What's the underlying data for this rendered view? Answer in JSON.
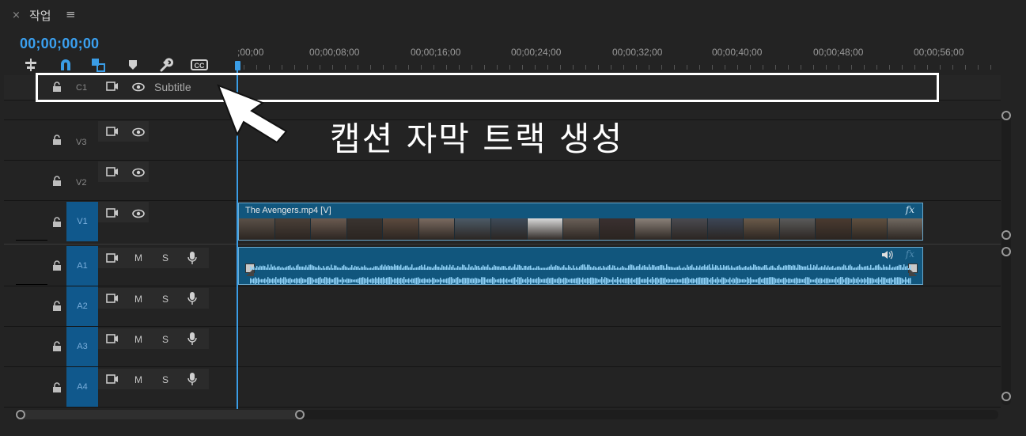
{
  "panel": {
    "close": "×",
    "title": "작업",
    "menu": "≡",
    "timecode": "00;00;00;00"
  },
  "toolbar": {
    "tools": [
      {
        "name": "insert-sequence-icon",
        "glyph": "⇟"
      },
      {
        "name": "snap-magnet-icon",
        "glyph": "∩"
      },
      {
        "name": "linked-selection-icon",
        "glyph": "◪"
      },
      {
        "name": "add-marker-icon",
        "glyph": "⯆"
      },
      {
        "name": "timeline-settings-wrench-icon",
        "glyph": "🔧"
      },
      {
        "name": "captions-cc-icon",
        "glyph": "CC"
      }
    ]
  },
  "ruler": {
    "labels": [
      ";00;00",
      "00;00;08;00",
      "00;00;16;00",
      "00;00;24;00",
      "00;00;32;00",
      "00;00;40;00",
      "00;00;48;00",
      "00;00;56;00"
    ]
  },
  "tracks": {
    "caption": {
      "id": "C1",
      "name": "Subtitle"
    },
    "video": [
      {
        "id": "V3"
      },
      {
        "id": "V2"
      },
      {
        "id": "V1"
      }
    ],
    "audio": [
      {
        "id": "A1",
        "m": "M",
        "s": "S"
      },
      {
        "id": "A2",
        "m": "M",
        "s": "S"
      },
      {
        "id": "A3",
        "m": "M",
        "s": "S"
      },
      {
        "id": "A4",
        "m": "M",
        "s": "S"
      }
    ]
  },
  "clips": {
    "video_name": "The Avengers.mp4 [V]",
    "fx": "fx"
  },
  "annotation": {
    "text": "캡션 자막 트랙 생성"
  },
  "colors": {
    "accent": "#3a9de6",
    "clip": "#11567d",
    "track_target": "#10588c",
    "annotation": "#ffffff"
  }
}
